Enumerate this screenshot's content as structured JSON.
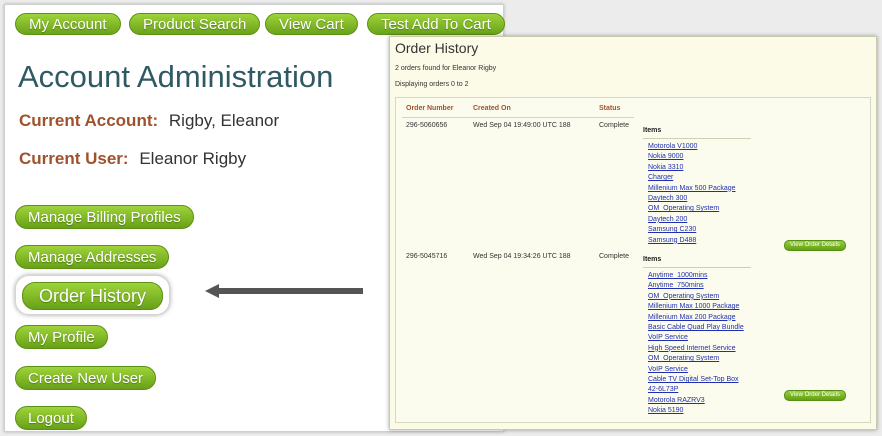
{
  "nav": {
    "my_account": "My Account",
    "product_search": "Product Search",
    "view_cart": "View Cart",
    "test_add_to_cart": "Test Add To Cart"
  },
  "account": {
    "title": "Account Administration",
    "current_account_label": "Current Account:",
    "current_account_value": "Rigby, Eleanor",
    "current_user_label": "Current User:",
    "current_user_value": "Eleanor Rigby"
  },
  "side_menu": {
    "manage_billing_profiles": "Manage Billing Profiles",
    "manage_addresses": "Manage Addresses",
    "order_history": "Order History",
    "my_profile": "My Profile",
    "create_new_user": "Create New User",
    "logout": "Logout"
  },
  "order_history": {
    "title": "Order History",
    "found_text": "2 orders found for Eleanor Rigby",
    "displaying_text": "Displaying orders 0 to 2",
    "columns": [
      "Order Number",
      "Created On",
      "Status"
    ],
    "items_label": "Items",
    "view_details_label": "View Order Details",
    "orders": [
      {
        "number": "296-5060656",
        "created": "Wed Sep 04 19:49:00 UTC 188",
        "status": "Complete",
        "items": [
          "Motorola V1000",
          "Nokia 9000",
          "Nokia 3310",
          "Charger",
          "Millenium Max 500 Package",
          "Daytech 300",
          "OM_Operating System",
          "Daytech 200",
          "Samsung C230",
          "Samsung D488"
        ]
      },
      {
        "number": "296-5045716",
        "created": "Wed Sep 04 19:34:26 UTC 188",
        "status": "Complete",
        "items": [
          "Anytime_1000mins",
          "Anytime_750mins",
          "OM_Operating System",
          "Millenium Max 1000 Package",
          "Millenium Max 200 Package",
          "Basic Cable Quad Play Bundle",
          "VoIP Service",
          "High Speed Internet Service",
          "OM_Operating System",
          "VoIP Service",
          "Cable TV Digital Set-Top Box",
          "42-6L73P",
          "Motorola RAZRV3",
          "Nokia 5190"
        ]
      }
    ]
  },
  "colors": {
    "accent_green": "#7cb623",
    "label_brown": "#a0522d",
    "title_teal": "#2f5a63",
    "link_blue": "#1f2fb0"
  }
}
